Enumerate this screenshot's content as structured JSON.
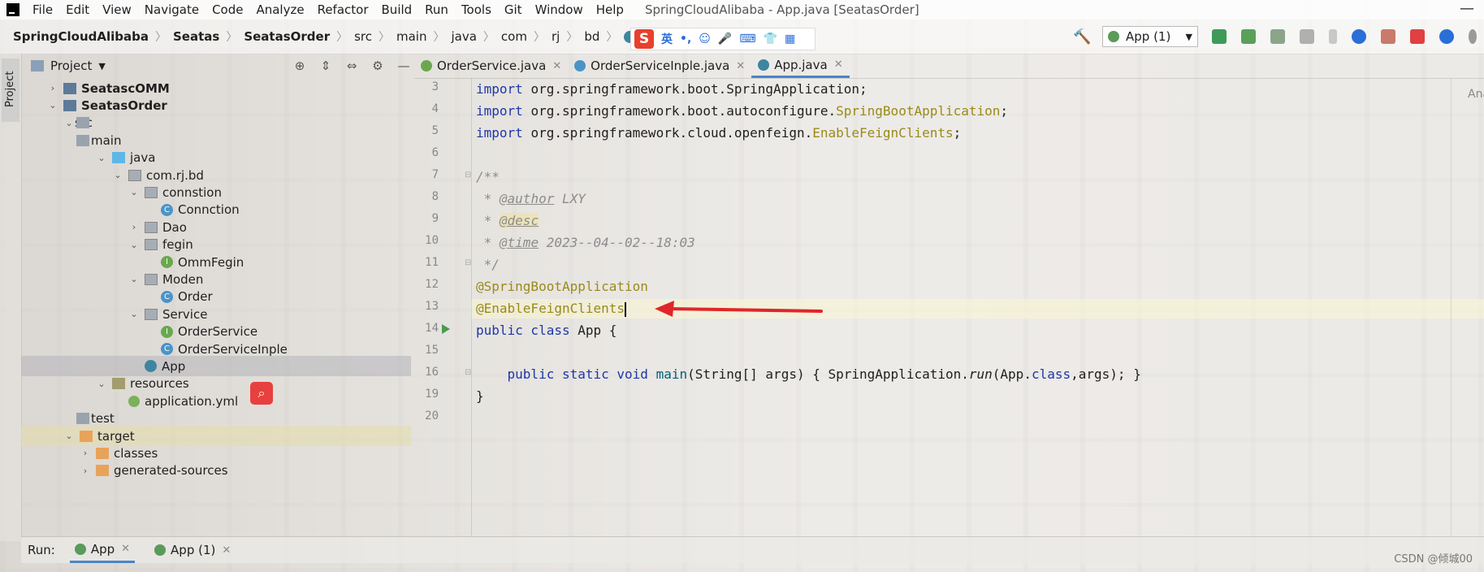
{
  "menubar": {
    "items": [
      "File",
      "Edit",
      "View",
      "Navigate",
      "Code",
      "Analyze",
      "Refactor",
      "Build",
      "Run",
      "Tools",
      "Git",
      "Window",
      "Help"
    ],
    "window_title": "SpringCloudAlibaba - App.java [SeatasOrder]",
    "minimize": "—"
  },
  "breadcrumb": [
    "SpringCloudAlibaba",
    "Seatas",
    "SeatasOrder",
    "src",
    "main",
    "java",
    "com",
    "rj",
    "bd",
    "App"
  ],
  "ime": {
    "logo": "S",
    "mode": "英"
  },
  "toolbar": {
    "run_config": "App (1)"
  },
  "sidebar": {
    "tab_label": "Project"
  },
  "project_panel": {
    "title": "Project"
  },
  "tree": [
    {
      "label": "SeatascOMM",
      "depth": 2,
      "icon": "module",
      "expanded": false,
      "bold": true
    },
    {
      "label": "SeatasOrder",
      "depth": 2,
      "icon": "module",
      "expanded": true,
      "bold": true
    },
    {
      "label": "src",
      "depth": 3,
      "icon": "folder",
      "expanded": true
    },
    {
      "label": "main",
      "depth": 4,
      "icon": "folder",
      "expanded": true
    },
    {
      "label": "java",
      "depth": 5,
      "icon": "source-folder",
      "expanded": true
    },
    {
      "label": "com.rj.bd",
      "depth": 6,
      "icon": "package",
      "expanded": true
    },
    {
      "label": "connstion",
      "depth": 7,
      "icon": "package",
      "expanded": true
    },
    {
      "label": "Conncti​on",
      "depth": 8,
      "icon": "class",
      "expanded": null
    },
    {
      "label": "Dao",
      "depth": 7,
      "icon": "package",
      "expanded": false
    },
    {
      "label": "fegin",
      "depth": 7,
      "icon": "package",
      "expanded": true
    },
    {
      "label": "OmmFegin",
      "depth": 8,
      "icon": "interface",
      "expanded": null
    },
    {
      "label": "Moden",
      "depth": 7,
      "icon": "package",
      "expanded": true
    },
    {
      "label": "Order",
      "depth": 8,
      "icon": "class",
      "expanded": null
    },
    {
      "label": "Service",
      "depth": 7,
      "icon": "package",
      "expanded": true
    },
    {
      "label": "OrderService",
      "depth": 8,
      "icon": "interface",
      "expanded": null
    },
    {
      "label": "OrderServiceInple",
      "depth": 8,
      "icon": "class",
      "expanded": null
    },
    {
      "label": "App",
      "depth": 7,
      "icon": "app",
      "expanded": null,
      "selected": true
    },
    {
      "label": "resources",
      "depth": 5,
      "icon": "resources",
      "expanded": true
    },
    {
      "label": "application.yml",
      "depth": 6,
      "icon": "yml",
      "expanded": null
    },
    {
      "label": "test",
      "depth": 4,
      "icon": "folder",
      "expanded": false
    },
    {
      "label": "target",
      "depth": 3,
      "icon": "target-folder",
      "expanded": true,
      "target": true
    },
    {
      "label": "classes",
      "depth": 4,
      "icon": "target-folder",
      "expanded": false
    },
    {
      "label": "generated-sources",
      "depth": 4,
      "icon": "target-folder",
      "expanded": false
    }
  ],
  "editor_tabs": [
    {
      "label": "OrderService.java",
      "kind": "interface",
      "active": false
    },
    {
      "label": "OrderServiceInple.java",
      "kind": "class",
      "active": false
    },
    {
      "label": "App.java",
      "kind": "app",
      "active": true
    }
  ],
  "code": {
    "lines": [
      {
        "num": "3",
        "parts": [
          [
            "kw",
            "import"
          ],
          [
            "",
            "org.springframework.boot.SpringApplication;"
          ]
        ]
      },
      {
        "num": "4",
        "parts": [
          [
            "kw",
            "import"
          ],
          [
            "",
            "org.springframework.boot.autoconfigure."
          ],
          [
            "ann",
            "SpringBootApplication"
          ],
          [
            "",
            ";"
          ]
        ]
      },
      {
        "num": "5",
        "parts": [
          [
            "kw",
            "import"
          ],
          [
            "",
            "org.springframework.cloud.openfeign."
          ],
          [
            "ann",
            "EnableFeignClients"
          ],
          [
            "",
            ";"
          ]
        ]
      },
      {
        "num": "6",
        "parts": []
      },
      {
        "num": "7",
        "parts": [
          [
            "cmt",
            "/**"
          ]
        ]
      },
      {
        "num": "8",
        "parts": [
          [
            "cmt",
            " * "
          ],
          [
            "tag",
            "@author"
          ],
          [
            "cmt",
            " LXY"
          ]
        ]
      },
      {
        "num": "9",
        "parts": [
          [
            "cmt",
            " * "
          ],
          [
            "tag tagbg",
            "@desc"
          ]
        ]
      },
      {
        "num": "10",
        "parts": [
          [
            "cmt",
            " * "
          ],
          [
            "tag",
            "@time"
          ],
          [
            "cmt",
            " 2023--04--02--18:03"
          ]
        ]
      },
      {
        "num": "11",
        "parts": [
          [
            "cmt",
            " */"
          ]
        ]
      },
      {
        "num": "12",
        "parts": [
          [
            "ann",
            "@SpringBootApplication"
          ]
        ]
      },
      {
        "num": "13",
        "parts": [
          [
            "ann",
            "@EnableFeignClients"
          ]
        ]
      },
      {
        "num": "14",
        "parts": [
          [
            "kw",
            "public class"
          ],
          [
            "",
            " App {"
          ]
        ]
      },
      {
        "num": "15",
        "parts": []
      },
      {
        "num": "16",
        "parts": [
          [
            "",
            "    "
          ],
          [
            "kw",
            "public static void"
          ],
          [
            "",
            " "
          ],
          [
            "fn",
            "main"
          ],
          [
            "",
            "(String[] args) { SpringApplication."
          ],
          [
            "it",
            "run"
          ],
          [
            "",
            "(App."
          ],
          [
            "kw",
            "class"
          ],
          [
            "",
            ",args); }"
          ]
        ]
      },
      {
        "num": "19",
        "parts": [
          [
            "",
            "}"
          ]
        ]
      },
      {
        "num": "20",
        "parts": []
      }
    ],
    "right_label": "Ana"
  },
  "run_panel": {
    "label": "Run:",
    "tabs": [
      "App",
      "App (1)"
    ]
  },
  "watermark": "CSDN @倾城00",
  "colors": {
    "keyword": "#1d37a8",
    "annotation": "#9a8a1a",
    "arrow": "#e0262a",
    "accent": "#4a86c8"
  }
}
